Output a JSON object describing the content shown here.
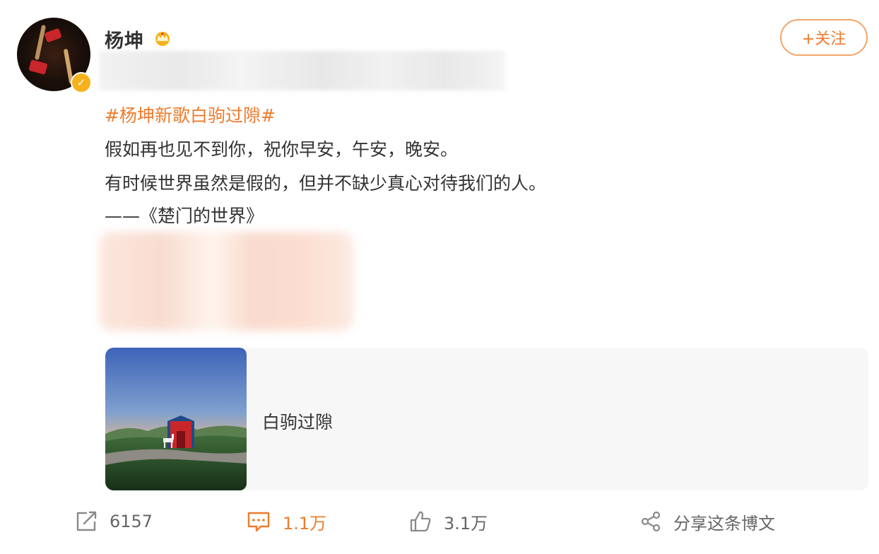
{
  "post": {
    "author_name": "杨坤",
    "follow_label": "+关注",
    "topic": "#杨坤新歌白驹过隙#",
    "lines": [
      "假如再也见不到你，祝你早安，午安，晚安。",
      "有时候世界虽然是假的，但并不缺少真心对待我们的人。",
      "——《楚门的世界》"
    ]
  },
  "card": {
    "title": "白驹过隙"
  },
  "actions": {
    "repost_count": "6157",
    "comment_count": "1.1万",
    "like_count": "3.1万",
    "share_label": "分享这条博文"
  },
  "colors": {
    "accent": "#ef7b2c",
    "verified": "#f6b21c"
  },
  "icons": {
    "repost": "repost-icon",
    "comment": "comment-icon",
    "like": "thumbs-up-icon",
    "share": "share-icon",
    "vip": "crown-icon",
    "verified": "verified-badge-icon"
  }
}
